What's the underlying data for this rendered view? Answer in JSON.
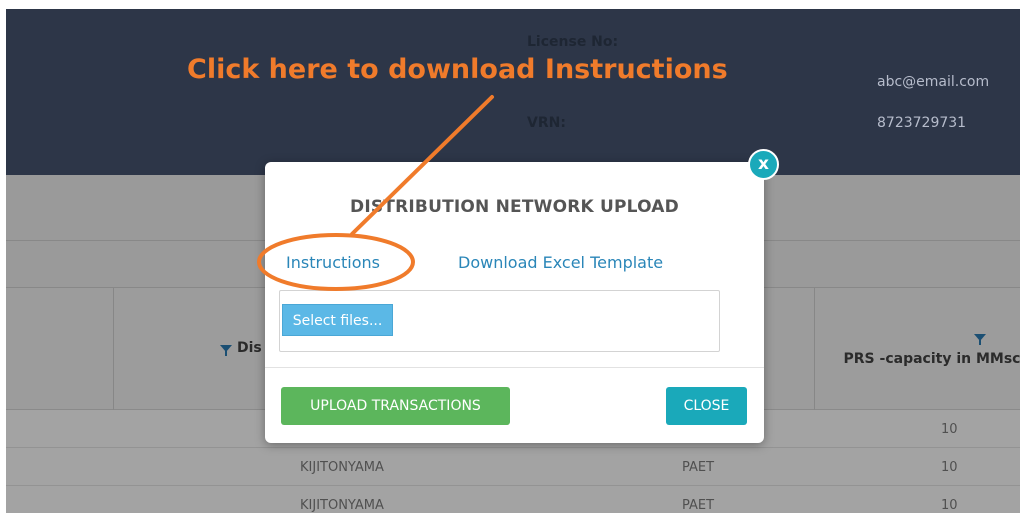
{
  "header": {
    "license_label": "License No:",
    "vrn_label": "VRN:",
    "email": "abc@email.com",
    "phone": "8723729731"
  },
  "table": {
    "col_distributor": "Dis",
    "col_prs": "PRS -capacity in MMsc",
    "rows": [
      {
        "name": "KIJITONYAMA",
        "code": "PAET",
        "capacity": "10"
      },
      {
        "name": "KIJITONYAMA",
        "code": "PAET",
        "capacity": "10"
      }
    ],
    "first_row_capacity": "10"
  },
  "modal": {
    "title": "DISTRIBUTION NETWORK UPLOAD",
    "instructions_link": "Instructions",
    "template_link": "Download Excel Template",
    "select_files": "Select files...",
    "upload_button": "UPLOAD TRANSACTIONS",
    "close_button": "CLOSE",
    "close_x": "x"
  },
  "annotation": {
    "text": "Click here to download Instructions",
    "color": "#f07b2b"
  },
  "colors": {
    "header_bg": "#2d3648",
    "overlay_gray": "#9a9a9a",
    "link_blue": "#2a86b8",
    "select_blue": "#5bb8e6",
    "upload_green": "#5cb65c",
    "close_teal": "#1aa9ba"
  }
}
